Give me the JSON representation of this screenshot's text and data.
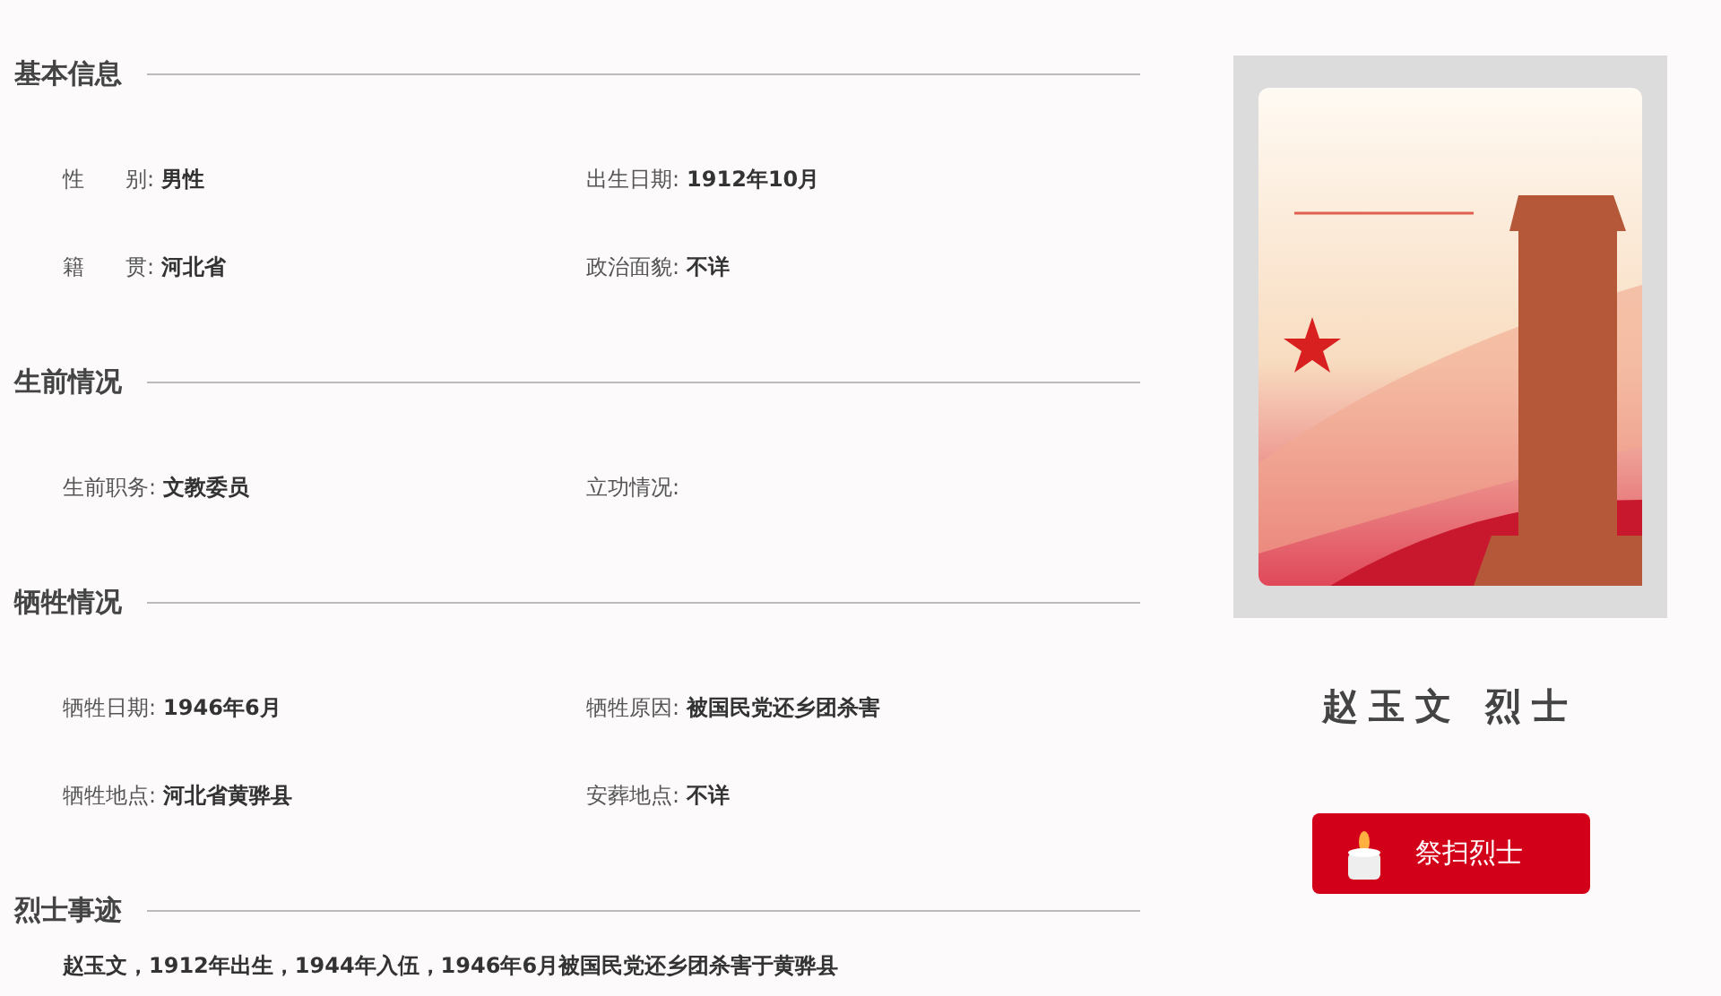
{
  "sections": [
    {
      "title": "基本信息",
      "fields": [
        {
          "label": "性 别:",
          "value": "男性"
        },
        {
          "label": "出生日期:",
          "value": "1912年10月"
        },
        {
          "label": "籍 贯:",
          "value": "河北省"
        },
        {
          "label": "政治面貌:",
          "value": "不详"
        }
      ]
    },
    {
      "title": "生前情况",
      "fields": [
        {
          "label": "生前职务:",
          "value": "文教委员"
        },
        {
          "label": "立功情况:"
        }
      ]
    },
    {
      "title": "牺牲情况",
      "fields": [
        {
          "label": "牺牲日期:",
          "value": "1946年6月"
        },
        {
          "label": "牺牲原因:",
          "value": "被国民党还乡团杀害"
        },
        {
          "label": "牺牲地点:",
          "value": "河北省黄骅县"
        },
        {
          "label": "安葬地点:",
          "value": "不详"
        }
      ]
    },
    {
      "title": "烈士事迹",
      "text": "赵玉文，1912年出生，1944年入伍，1946年6月被国民党还乡团杀害于黄骅县"
    }
  ],
  "profile": {
    "name": "赵玉文 烈士",
    "button": "祭扫烈士"
  }
}
